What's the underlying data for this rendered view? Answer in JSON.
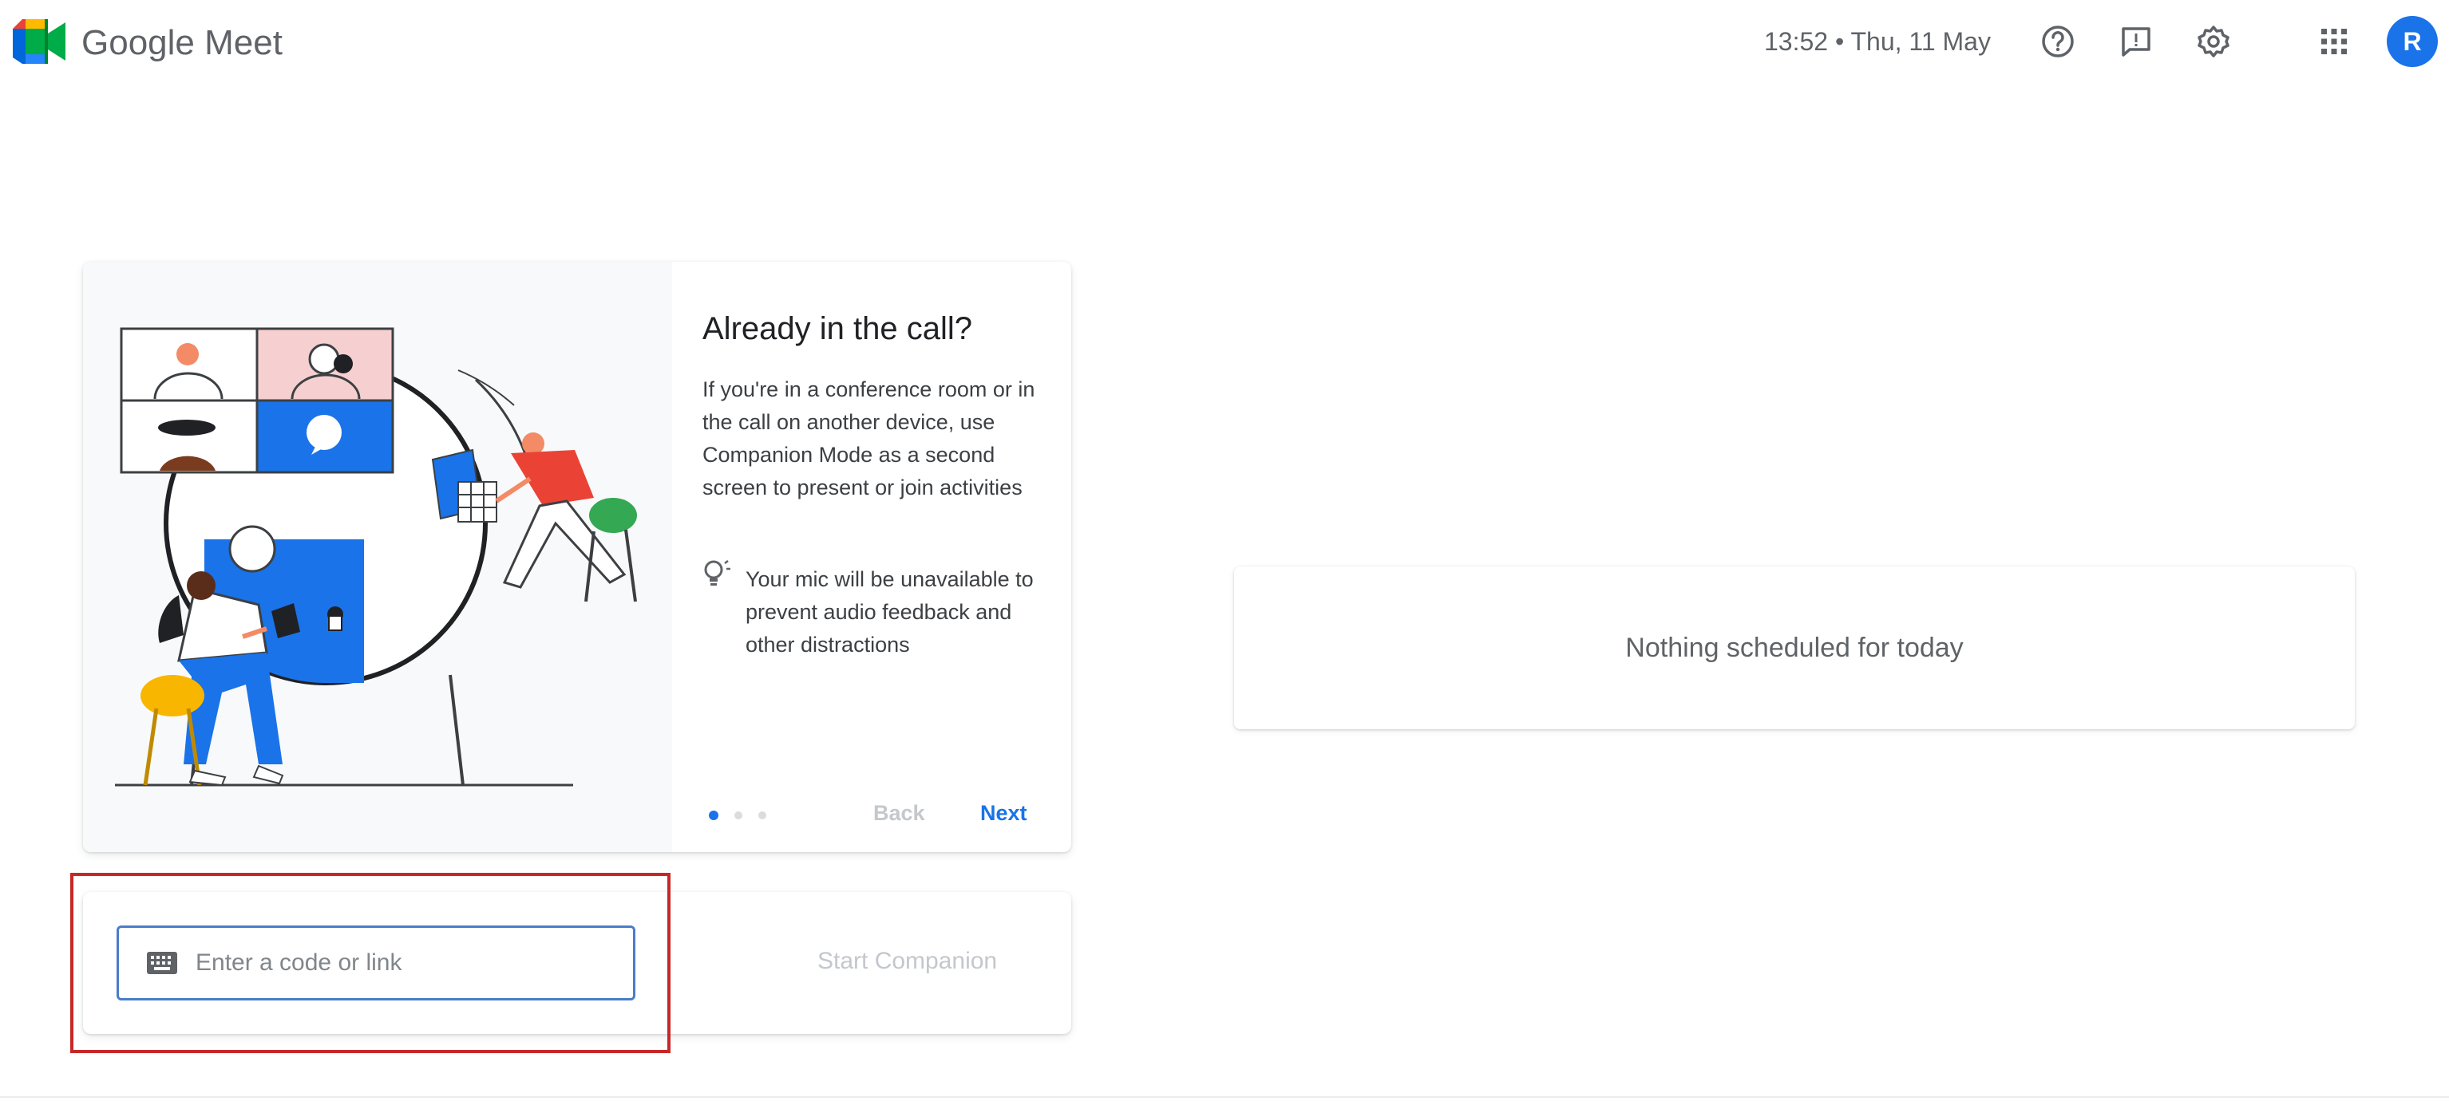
{
  "header": {
    "app_name": "Google Meet",
    "datetime": "13:52 • Thu, 11 May",
    "avatar_initial": "R",
    "icons": [
      "help-icon",
      "feedback-icon",
      "settings-icon",
      "apps-grid-icon"
    ]
  },
  "companion_card": {
    "title": "Already in the call?",
    "body": "If you're in a conference room or in the call on another device, use Companion Mode as a second screen to present or join activities",
    "tip": "Your mic will be unavailable to prevent audio feedback and other distractions",
    "back_label": "Back",
    "next_label": "Next",
    "page_count": 3,
    "current_page": 1
  },
  "join": {
    "placeholder": "Enter a code or link",
    "value": "",
    "start_label": "Start Companion"
  },
  "schedule": {
    "empty_text": "Nothing scheduled for today"
  },
  "colors": {
    "accent": "#1a73e8",
    "highlight_box": "#c62828",
    "meet_green": "#00832d",
    "meet_yellow": "#ffba00",
    "meet_red": "#ea4335"
  }
}
